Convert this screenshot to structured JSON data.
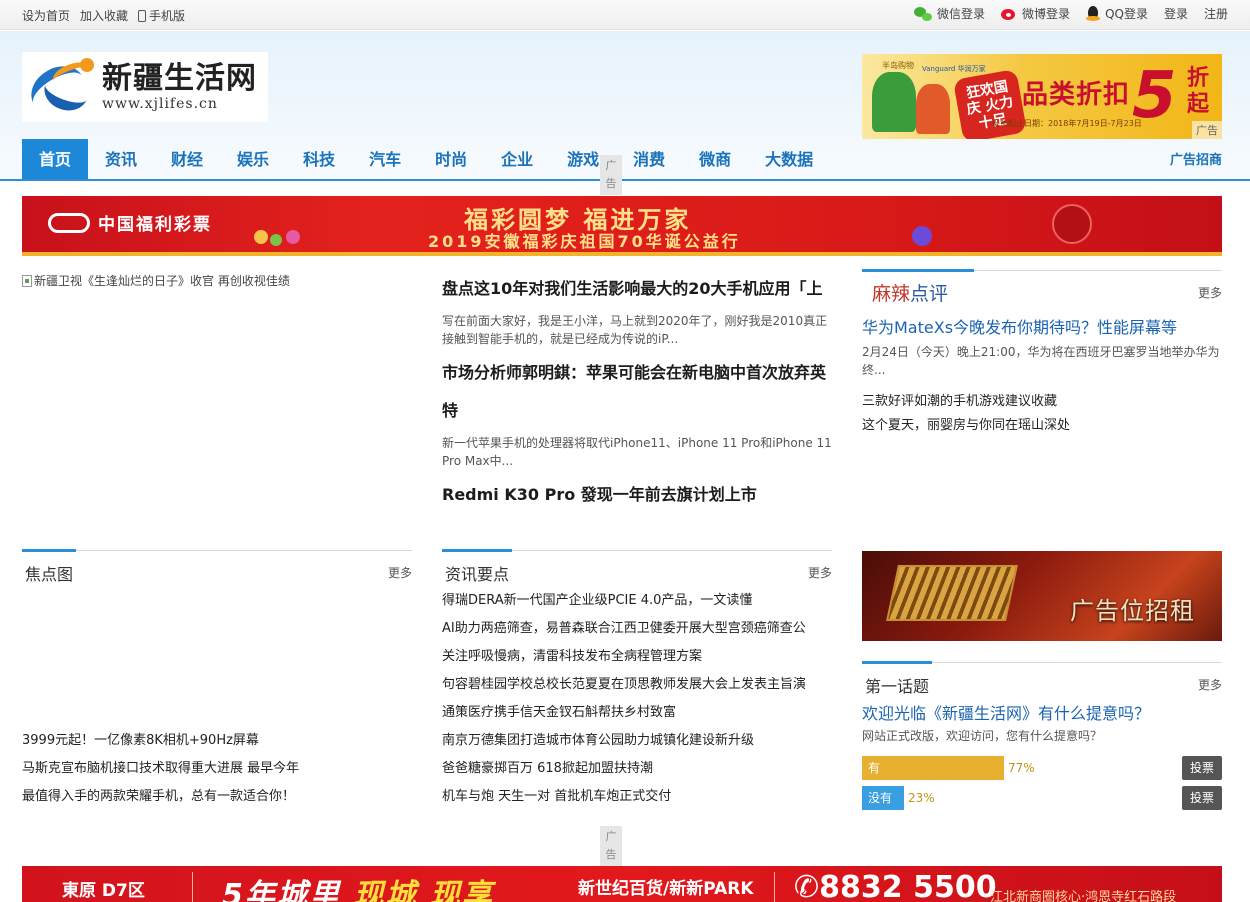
{
  "topbar": {
    "set_home": "设为首页",
    "bookmark": "加入收藏",
    "mobile": "手机版",
    "wechat_login": "微信登录",
    "weibo_login": "微博登录",
    "qq_login": "QQ登录",
    "login": "登录",
    "register": "注册"
  },
  "logo": {
    "title": "新疆生活网",
    "url": "www.xjlifes.cn"
  },
  "top_ad": {
    "main": "品类折扣",
    "big": "5",
    "unit": "折起",
    "badge": "狂欢国庆 火力十足",
    "date": "促销起止日期：2018年7月19日-7月23日",
    "brand1": "半岛购物",
    "brand2": "Vanguard 华润万家",
    "ad_tag": "广告"
  },
  "nav": {
    "items": [
      "首页",
      "资讯",
      "财经",
      "娱乐",
      "科技",
      "汽车",
      "时尚",
      "企业",
      "游戏",
      "消费",
      "微商",
      "大数据"
    ],
    "right": "广告招商",
    "ad_label": "广告"
  },
  "lottery": {
    "logo": "中国福利彩票",
    "headline": "福彩圆梦  福进万家",
    "subline": "2019安徽福彩庆祖国70华诞公益行"
  },
  "focus_image_alt": "新疆卫视《生逢灿烂的日子》收官 再创收视佳绩",
  "articles": [
    {
      "title": "盘点这10年对我们生活影响最大的20大手机应用「上",
      "desc": "写在前面大家好，我是王小洋，马上就到2020年了，刚好我是2010真正接触到智能手机的，就是已经成为传说的iP..."
    },
    {
      "title": "市场分析师郭明錤：苹果可能会在新电脑中首次放弃英特",
      "desc": "新一代苹果手机的处理器将取代iPhone11、iPhone 11 Pro和iPhone 11 Pro Max中..."
    },
    {
      "title": "Redmi K30 Pro 發现一年前去旗计划上市"
    }
  ],
  "mala": {
    "title_a": "麻辣",
    "title_b": "点评",
    "more": "更多",
    "headline": "华为MateXs今晚发布你期待吗？性能屏幕等",
    "desc": "2月24日（今天）晚上21:00，华为将在西班牙巴塞罗当地举办华为终...",
    "links": [
      "三款好评如潮的手机游戏建议收藏",
      "这个夏天，丽婴房与你同在瑶山深处"
    ]
  },
  "focus_section": {
    "title": "焦点图",
    "more": "更多",
    "items": [
      "3999元起！一亿像素8K相机+90Hz屏幕",
      "马斯克宣布脑机接口技术取得重大进展 最早今年",
      "最值得入手的两款荣耀手机，总有一款适合你！"
    ]
  },
  "news_section": {
    "title": "资讯要点",
    "more": "更多",
    "items": [
      "得瑞DERA新一代国产企业级PCIE 4.0产品，一文读懂",
      "AI助力两癌筛查，易普森联合江西卫健委开展大型宫颈癌筛查公",
      "关注呼吸慢病，清雷科技发布全病程管理方案",
      "句容碧桂园学校总校长范夏夏在顶思教师发展大会上发表主旨演",
      "通策医疗携手信天金钗石斛帮扶乡村致富",
      "南京万德集团打造城市体育公园助力城镇化建设新升级",
      "爸爸糖豪掷百万 618掀起加盟扶持潮",
      "机车与炮 天生一对 首批机车炮正式交付"
    ]
  },
  "ad_rent": {
    "text": "广告位招租"
  },
  "topic": {
    "title": "第一话题",
    "more": "更多",
    "question": "欢迎光临《新疆生活网》有什么提意吗？",
    "desc": "网站正式改版，欢迎访问，您有什么提意吗？",
    "options": [
      {
        "label": "有",
        "percent": "77%",
        "value": 77,
        "color": "#e8b030"
      },
      {
        "label": "没有",
        "percent": "23%",
        "value": 23,
        "color": "#3a9fe0"
      }
    ],
    "vote_label": "投票"
  },
  "bottom_ad": {
    "brand": "東原 D7区",
    "slogan_a": "5年城里 ",
    "slogan_b": "现城 现享",
    "mall": "新世纪百货/新新PARK",
    "phone": "8832 5500",
    "address": "江北新商圈核心·鸿恩寺红石路段",
    "ad_label": "广告"
  }
}
